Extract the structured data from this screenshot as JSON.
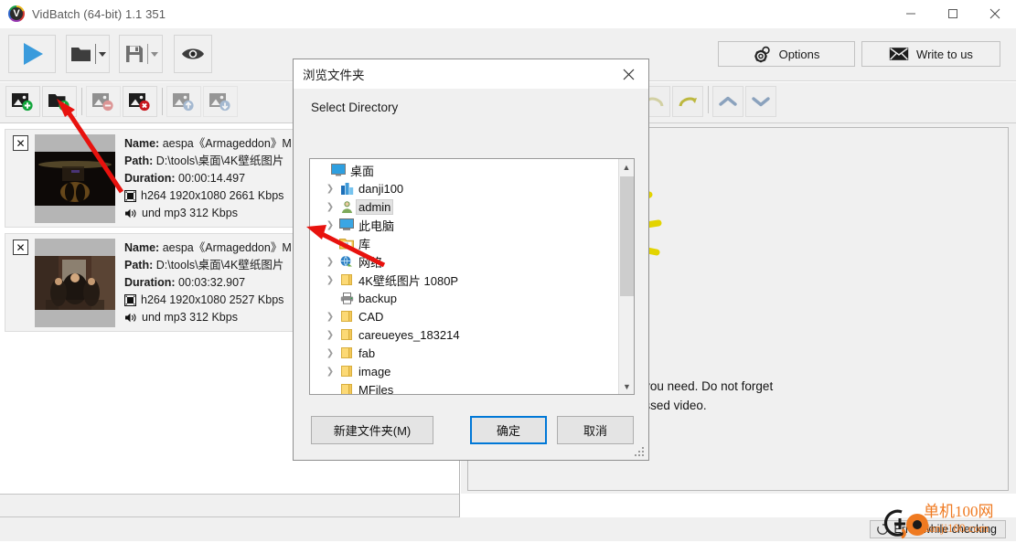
{
  "window": {
    "title": "VidBatch (64-bit) 1.1 351",
    "logo_icon": "vidbatch-logo-icon",
    "minimize": "—",
    "maximize": "☐",
    "close": "✕"
  },
  "toolbar": {
    "play_icon": "play-icon",
    "open_icon": "open-folder-icon",
    "save_icon": "save-icon",
    "preview_icon": "eye-icon",
    "options_label": "Options",
    "options_icon": "gear-icon",
    "write_label": "Write to us",
    "write_icon": "envelope-icon"
  },
  "list_toolbar": {
    "buttons": [
      {
        "name": "add-file-button",
        "icon": "image-add-icon",
        "enabled": true
      },
      {
        "name": "add-folder-button",
        "icon": "folder-add-icon",
        "enabled": true
      },
      {
        "name": "remove-button",
        "icon": "image-remove-icon",
        "enabled": false
      },
      {
        "name": "delete-button",
        "icon": "image-delete-icon",
        "enabled": true
      },
      {
        "name": "move-up-button",
        "icon": "image-up-icon",
        "enabled": false
      },
      {
        "name": "move-down-button",
        "icon": "image-down-icon",
        "enabled": false
      }
    ]
  },
  "right_toolbar": {
    "buttons": [
      {
        "name": "undo-button",
        "icon": "undo-arrow-icon",
        "enabled": false
      },
      {
        "name": "redo-button",
        "icon": "redo-arrow-icon",
        "enabled": true
      },
      {
        "name": "task-up-button",
        "icon": "chevron-up-icon",
        "enabled": true
      },
      {
        "name": "task-down-button",
        "icon": "chevron-down-icon",
        "enabled": true
      }
    ]
  },
  "tasks": [
    {
      "close_label": "✕",
      "name_label": "Name:",
      "name_value": "aespa《Armageddon》M",
      "path_label": "Path:",
      "path_value": "D:\\tools\\桌面\\4K壁纸图片",
      "duration_label": "Duration:",
      "duration_value": "00:00:14.497",
      "video_icon": "film-icon",
      "video_value": "h264 1920x1080 2661 Kbps",
      "audio_icon": "speaker-icon",
      "audio_value": "und mp3 312 Kbps"
    },
    {
      "close_label": "✕",
      "name_label": "Name:",
      "name_value": "aespa《Armageddon》M",
      "path_label": "Path:",
      "path_value": "D:\\tools\\桌面\\4K壁纸图片",
      "duration_label": "Duration:",
      "duration_value": "00:03:32.907",
      "video_icon": "film-icon",
      "video_value": "h264 1920x1080 2527 Kbps",
      "audio_icon": "speaker-icon",
      "audio_value": "und mp3 312 Kbps"
    }
  ],
  "hint": {
    "illustration": "lightbulb-gears-icon",
    "line1": " to add as many tasks here as you need. Do not forget",
    "line2": "ave as\" task to save the processed video."
  },
  "statusbar": {
    "spinner_icon": "spinner-icon",
    "text": "Error while checking"
  },
  "watermark": {
    "title": "单机100网",
    "subtitle": "danji100.com",
    "color": "#ef7a21"
  },
  "dialog": {
    "title": "浏览文件夹",
    "close_label": "✕",
    "prompt": "Select Directory",
    "tree": [
      {
        "label": "桌面",
        "icon": "desktop-icon",
        "chevron": false,
        "indent": 0,
        "selected": false
      },
      {
        "label": "danji100",
        "icon": "app-icon",
        "chevron": true,
        "indent": 1,
        "selected": false
      },
      {
        "label": "admin",
        "icon": "user-icon",
        "chevron": true,
        "indent": 1,
        "selected": true
      },
      {
        "label": "此电脑",
        "icon": "computer-icon",
        "chevron": true,
        "indent": 1,
        "selected": false
      },
      {
        "label": "库",
        "icon": "library-icon",
        "chevron": false,
        "indent": 1,
        "selected": false
      },
      {
        "label": "网络",
        "icon": "network-icon",
        "chevron": true,
        "indent": 1,
        "selected": false
      },
      {
        "label": "4K壁纸图片 1080P",
        "icon": "folder-icon",
        "chevron": true,
        "indent": 1,
        "selected": false
      },
      {
        "label": "backup",
        "icon": "printer-icon",
        "chevron": false,
        "indent": 1,
        "selected": false
      },
      {
        "label": "CAD",
        "icon": "folder-icon",
        "chevron": true,
        "indent": 1,
        "selected": false
      },
      {
        "label": "careueyes_183214",
        "icon": "folder-icon",
        "chevron": true,
        "indent": 1,
        "selected": false
      },
      {
        "label": "fab",
        "icon": "folder-icon",
        "chevron": true,
        "indent": 1,
        "selected": false
      },
      {
        "label": "image",
        "icon": "folder-icon",
        "chevron": true,
        "indent": 1,
        "selected": false
      },
      {
        "label": "MFiles",
        "icon": "folder-icon",
        "chevron": false,
        "indent": 1,
        "selected": false
      }
    ],
    "scroll_up_icon": "scroll-up-icon",
    "scroll_down_icon": "scroll-down-icon",
    "new_folder_label": "新建文件夹(M)",
    "ok_label": "确定",
    "cancel_label": "取消"
  },
  "annotations": {
    "arrow_color": "#e8120e",
    "arrow1_target": "add-folder-button",
    "arrow2_target": "tree-item-library"
  },
  "colors": {
    "accent_blue": "#0078d7",
    "play_blue": "#3a9bdc",
    "bulb_yellow": "#e3d400",
    "folder_yellow": "#fcd975",
    "watermark_orange": "#ef7a21"
  }
}
